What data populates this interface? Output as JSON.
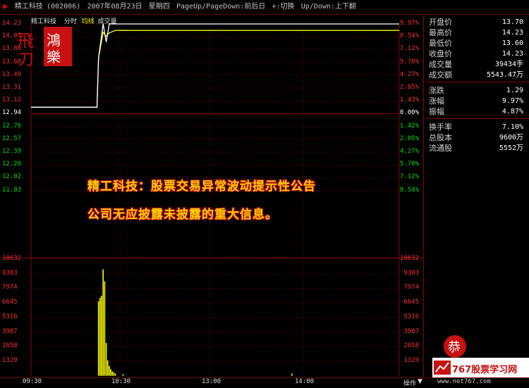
{
  "top_bar": {
    "stock_name": "精工科技",
    "stock_code": "(002006)",
    "date": "2007年08月23日",
    "weekday": "星期四",
    "nav_hint": "PageUp/PageDown:前后日",
    "switch_hint": "+:切换",
    "updown_hint": "Up/Down:上下翻"
  },
  "chart_header": {
    "stock_name": "精工科技",
    "labels": [
      "分时",
      "均线",
      "成交量"
    ]
  },
  "price_axis": {
    "left": [
      "14.23",
      "14.05",
      "13.86",
      "13.68",
      "13.49",
      "13.31",
      "13.12",
      "12.94",
      "12.76",
      "12.57",
      "12.39",
      "12.20",
      "12.02",
      "11.83"
    ],
    "right": [
      "9.97%",
      "8.54%",
      "7.12%",
      "5.70%",
      "4.27%",
      "2.85%",
      "1.43%",
      "0.00%",
      "1.42%",
      "2.85%",
      "4.27%",
      "5.70%",
      "7.12%",
      "8.54%"
    ]
  },
  "volume_axis": {
    "left": [
      "10632",
      "9303",
      "7974",
      "6645",
      "5316",
      "3987",
      "2658",
      "1329"
    ],
    "right": [
      "10632",
      "9303",
      "7974",
      "6645",
      "5316",
      "3987",
      "2658",
      "1329"
    ]
  },
  "time_axis": [
    "09:30",
    "10:30",
    "13:00",
    "14:00"
  ],
  "chart_data": {
    "type": "line",
    "prev_close": 12.94,
    "open_price": 13.7,
    "limit_up_price": 14.23,
    "ylim_price": [
      11.65,
      14.23
    ],
    "volume_ylim": [
      0,
      10632
    ],
    "x_time_points": [
      "10:10",
      "10:13",
      "10:14",
      "10:17",
      "10:19",
      "10:21",
      "10:25",
      "15:00"
    ],
    "price_series": [
      12.94,
      12.94,
      13.7,
      14.23,
      13.95,
      14.23,
      14.23,
      14.23
    ],
    "avg_series": [
      12.94,
      12.94,
      13.7,
      14.1,
      14.04,
      14.09,
      14.13,
      14.13
    ],
    "volume_times": [
      "10:14",
      "10:15",
      "10:16",
      "10:17",
      "10:18",
      "10:19",
      "10:20",
      "10:21",
      "10:22",
      "10:23",
      "10:24",
      "10:25",
      "10:30",
      "13:50"
    ],
    "volumes": [
      6800,
      7100,
      7300,
      9700,
      8600,
      3000,
      1400,
      900,
      600,
      400,
      300,
      200,
      150,
      200
    ]
  },
  "overlay": {
    "line1": "精工科技：股票交易异常波动提示性公告",
    "line2": "公司无应披露未披露的重大信息。"
  },
  "quote_panel": {
    "group1": [
      {
        "label": "开盘价",
        "value": "13.70"
      },
      {
        "label": "最高价",
        "value": "14.23"
      },
      {
        "label": "最低价",
        "value": "13.60"
      },
      {
        "label": "收盘价",
        "value": "14.23"
      },
      {
        "label": "成交量",
        "value": "39434手"
      },
      {
        "label": "成交额",
        "value": "5543.47万"
      }
    ],
    "group2": [
      {
        "label": "涨跌",
        "value": "1.29"
      },
      {
        "label": "涨幅",
        "value": "9.97%"
      },
      {
        "label": "振幅",
        "value": "4.87%"
      }
    ],
    "group3": [
      {
        "label": "换手率",
        "value": "7.10%"
      },
      {
        "label": "总股本",
        "value": "9600万"
      },
      {
        "label": "流通股",
        "value": "5552万"
      }
    ]
  },
  "status_bar": {
    "operation": "操作",
    "website": "www.net767.com",
    "brand": "767股票学习网"
  },
  "logos": {
    "top_left": "飞狐",
    "bottom_right_seal": "恭"
  },
  "colors": {
    "price_line": "#ffffff",
    "avg_line": "#ffff00",
    "volume_bar": "#ffff00",
    "rise": "#ff3030",
    "fall": "#00e000",
    "grid": "#8b0000"
  }
}
